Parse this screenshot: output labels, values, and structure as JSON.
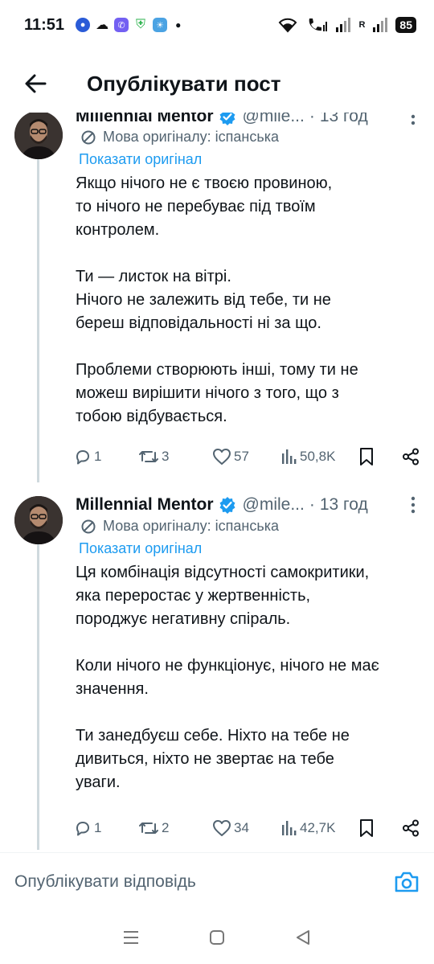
{
  "status": {
    "time": "11:51",
    "battery": "85",
    "roaming": "R"
  },
  "header": {
    "title": "Опублікувати пост"
  },
  "tweets": [
    {
      "author": "Millennial Mentor",
      "handle": "@mile...",
      "separator": "·",
      "time": "13 год",
      "original_language": "Мова оригіналу: іспанська",
      "show_original": "Показати оригінал",
      "text": "Якщо нічого не є твоєю провиною,\nто нічого не перебуває під твоїм\nконтролем.\n\nТи — листок на вітрі.\nНічого не залежить від тебе, ти не\nбереш відповідальності ні за що.\n\nПроблеми створюють інші, тому ти не\nможеш вирішити нічого з того, що з\nтобою відбувається.",
      "replies": "1",
      "reposts": "3",
      "likes": "57",
      "views": "50,8K"
    },
    {
      "author": "Millennial Mentor",
      "handle": "@mile...",
      "separator": "·",
      "time": "13 год",
      "original_language": "Мова оригіналу: іспанська",
      "show_original": "Показати оригінал",
      "text": "Ця комбінація відсутності самокритики,\nяка переростає у жертвенність,\nпороджує негативну спіраль.\n\nКоли нічого не функціонує, нічого не має\nзначення.\n\nТи занедбуєш себе. Ніхто на тебе не\nдивиться, ніхто не звертає на тебе\nуваги.",
      "replies": "1",
      "reposts": "2",
      "likes": "34",
      "views": "42,7K"
    }
  ],
  "reply": {
    "placeholder": "Опублікувати відповідь"
  },
  "icons": {
    "back": "arrow-left-icon",
    "verified": "verified-badge-icon",
    "more": "more-vertical-icon",
    "translate": "translate-icon",
    "reply": "reply-icon",
    "repost": "repost-icon",
    "like": "heart-icon",
    "views": "views-icon",
    "bookmark": "bookmark-icon",
    "share": "share-icon",
    "camera": "camera-icon"
  },
  "colors": {
    "accent": "#1d9bf0",
    "secondary_text": "#536471",
    "text": "#0f1419"
  }
}
